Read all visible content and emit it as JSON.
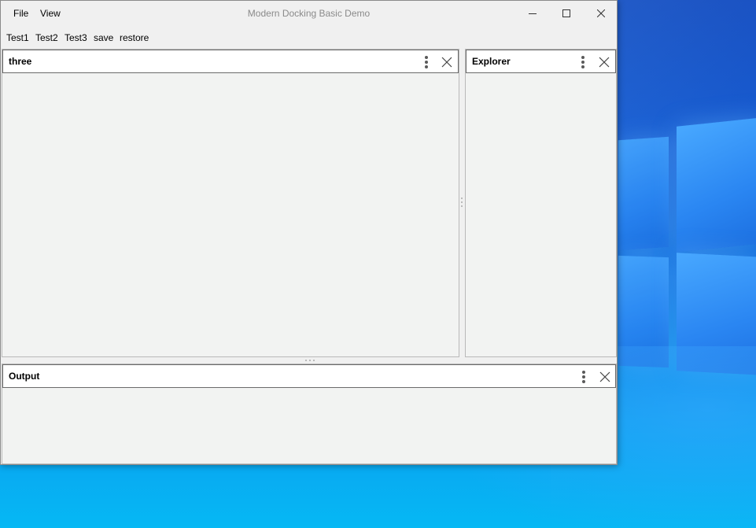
{
  "window": {
    "title": "Modern Docking Basic Demo",
    "menu": [
      "File",
      "View"
    ]
  },
  "toolbar": {
    "items": [
      "Test1",
      "Test2",
      "Test3",
      "save",
      "restore"
    ]
  },
  "docks": {
    "main": {
      "title": "three"
    },
    "explorer": {
      "title": "Explorer"
    },
    "output": {
      "title": "Output"
    }
  },
  "icons": {
    "minimize": "minimize-icon",
    "maximize": "maximize-icon",
    "close": "close-icon",
    "options": "more-vertical-icon"
  },
  "colors": {
    "title_text": "#8a8a8a",
    "panel_background": "#f2f3f2",
    "header_background": "#ffffff",
    "desktop_accent": "#0a6fe0"
  }
}
